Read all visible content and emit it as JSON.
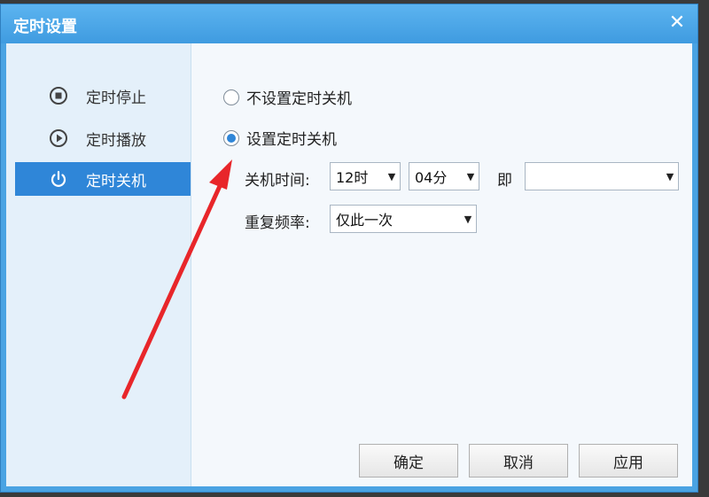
{
  "window": {
    "title": "定时设置"
  },
  "sidebar": {
    "items": [
      {
        "label": "定时停止",
        "icon": "stop-circle-icon"
      },
      {
        "label": "定时播放",
        "icon": "play-circle-icon"
      },
      {
        "label": "定时关机",
        "icon": "power-icon",
        "active": true
      }
    ]
  },
  "options": {
    "no_shutdown": "不设置定时关机",
    "set_shutdown": "设置定时关机",
    "selected": "set_shutdown"
  },
  "shutdown_time": {
    "label": "关机时间:",
    "hour": "12时",
    "minute": "04分",
    "ji_label": "即",
    "ji_value": ""
  },
  "repeat": {
    "label": "重复频率:",
    "value": "仅此一次"
  },
  "buttons": {
    "ok": "确定",
    "cancel": "取消",
    "apply": "应用"
  },
  "colors": {
    "accent": "#2f86d8",
    "title_bar": "#4aa3e3",
    "arrow": "#e8262a"
  }
}
